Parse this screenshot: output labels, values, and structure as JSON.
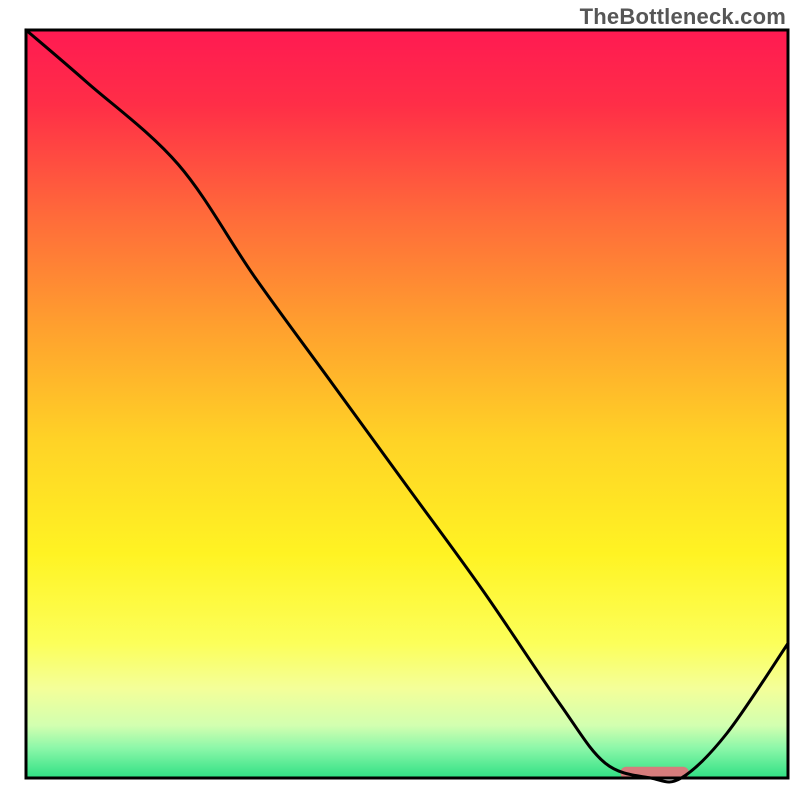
{
  "watermark": "TheBottleneck.com",
  "chart_data": {
    "type": "line",
    "title": "",
    "xlabel": "",
    "ylabel": "",
    "xlim": [
      0,
      100
    ],
    "ylim": [
      0,
      100
    ],
    "grid": false,
    "series": [
      {
        "name": "curve",
        "x": [
          0,
          8,
          20,
          30,
          40,
          50,
          60,
          70,
          76,
          82,
          86,
          92,
          100
        ],
        "y": [
          100,
          93,
          82,
          67,
          53,
          39,
          25,
          10,
          2,
          0,
          0,
          6,
          18
        ]
      }
    ],
    "marker": {
      "x_start": 78,
      "x_end": 87,
      "color": "#d67c7c"
    },
    "background_gradient": {
      "stops": [
        {
          "offset": 0.0,
          "color": "#ff1a52"
        },
        {
          "offset": 0.1,
          "color": "#ff2e47"
        },
        {
          "offset": 0.25,
          "color": "#ff6b3a"
        },
        {
          "offset": 0.4,
          "color": "#ffa12e"
        },
        {
          "offset": 0.55,
          "color": "#ffd326"
        },
        {
          "offset": 0.7,
          "color": "#fff323"
        },
        {
          "offset": 0.82,
          "color": "#fcff5a"
        },
        {
          "offset": 0.88,
          "color": "#f4ff99"
        },
        {
          "offset": 0.93,
          "color": "#d2ffb0"
        },
        {
          "offset": 0.96,
          "color": "#8cf7a9"
        },
        {
          "offset": 1.0,
          "color": "#2fe084"
        }
      ]
    },
    "frame_color": "#000000",
    "frame_width": 3,
    "line_color": "#000000",
    "line_width": 3
  }
}
